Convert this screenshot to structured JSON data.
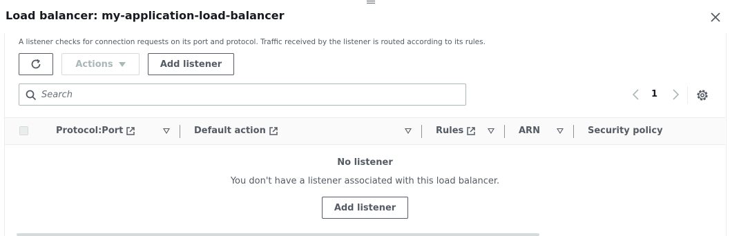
{
  "modal": {
    "title": "Load balancer: my-application-load-balancer"
  },
  "listeners": {
    "description": "A listener checks for connection requests on its port and protocol. Traffic received by the listener is routed according to its rules.",
    "toolbar": {
      "actions_label": "Actions",
      "add_listener_label": "Add listener"
    },
    "search": {
      "placeholder": "Search"
    },
    "pagination": {
      "current_page": "1"
    },
    "columns": {
      "protocol_port": "Protocol:Port",
      "default_action": "Default action",
      "rules": "Rules",
      "arn": "ARN",
      "security_policy": "Security policy"
    },
    "empty": {
      "title": "No listener",
      "description": "You don't have a listener associated with this load balancer.",
      "button_label": "Add listener"
    }
  },
  "icons": {
    "close": "close-icon",
    "refresh": "refresh-icon",
    "search": "search-icon",
    "prev": "chevron-left-icon",
    "next": "chevron-right-icon",
    "settings": "gear-icon",
    "external": "external-link-icon",
    "sort": "sort-caret-icon"
  },
  "colors": {
    "text": "#16191f",
    "secondary_text": "#545b64",
    "border": "#aab7b8",
    "disabled": "#aab7b8"
  }
}
